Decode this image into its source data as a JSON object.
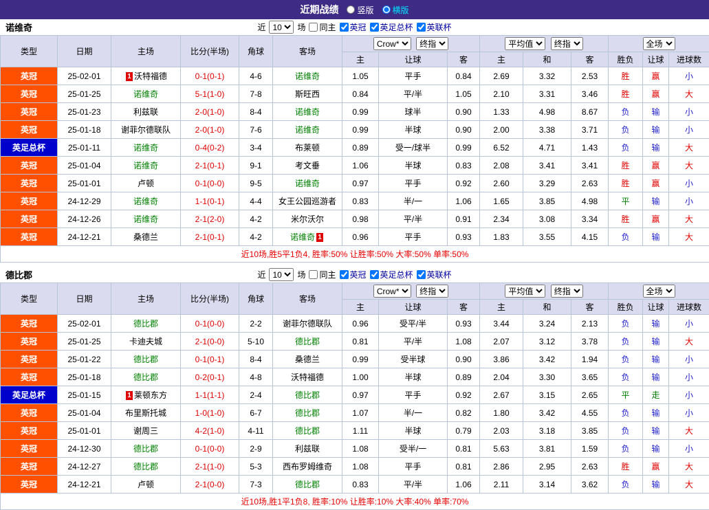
{
  "topbar": {
    "title": "近期战绩",
    "vertical_label": "竖版",
    "horizontal_label": "横版",
    "vertical_checked": false,
    "horizontal_checked": true
  },
  "controls": {
    "near_label": "近",
    "match_count": "10",
    "games_label": "场",
    "same_home_label": "同主",
    "same_home_checked": false,
    "league_filters": [
      {
        "label": "英冠",
        "checked": true
      },
      {
        "label": "英足总杯",
        "checked": true
      },
      {
        "label": "英联杯",
        "checked": true
      }
    ]
  },
  "columns": {
    "type": "类型",
    "date": "日期",
    "home": "主场",
    "score": "比分(半场)",
    "corner": "角球",
    "away": "客场",
    "asian_select": "Crow*",
    "asian_final_select": "终指",
    "asian_sub": [
      "主",
      "让球",
      "客"
    ],
    "euro_select": "平均值",
    "euro_final_select": "终指",
    "euro_sub": [
      "主",
      "和",
      "客"
    ],
    "full_select": "全场",
    "full_sub": [
      "胜负",
      "让球",
      "进球数"
    ]
  },
  "league_colors": {
    "英冠": "#ff5000",
    "英足总杯": "#0000cc"
  },
  "result_colors": {
    "胜": "#e00000",
    "负": "#2222cc",
    "平": "#008000",
    "赢": "#e00000",
    "输": "#2222cc",
    "走": "#008000",
    "大": "#e00000",
    "小": "#2222cc"
  },
  "sections": [
    {
      "team": "诺维奇",
      "summary": "近10场,胜5平1负4, 胜率:50% 让胜率:50% 大率:50% 单率:50%",
      "rows": [
        {
          "league": "英冠",
          "date": "25-02-01",
          "home": {
            "name": "沃特福德",
            "focus": false,
            "badge": "1",
            "badge_pos": "left"
          },
          "score": "0-1(0-1)",
          "corner": "4-6",
          "away": {
            "name": "诺维奇",
            "focus": true
          },
          "asian": [
            "1.05",
            "平手",
            "0.84"
          ],
          "euro": [
            "2.69",
            "3.32",
            "2.53"
          ],
          "result": [
            "胜",
            "赢",
            "小"
          ]
        },
        {
          "league": "英冠",
          "date": "25-01-25",
          "home": {
            "name": "诺维奇",
            "focus": true
          },
          "score": "5-1(1-0)",
          "corner": "7-8",
          "away": {
            "name": "斯旺西",
            "focus": false
          },
          "asian": [
            "0.84",
            "平/半",
            "1.05"
          ],
          "euro": [
            "2.10",
            "3.31",
            "3.46"
          ],
          "result": [
            "胜",
            "赢",
            "大"
          ]
        },
        {
          "league": "英冠",
          "date": "25-01-23",
          "home": {
            "name": "利兹联",
            "focus": false
          },
          "score": "2-0(1-0)",
          "corner": "8-4",
          "away": {
            "name": "诺维奇",
            "focus": true
          },
          "asian": [
            "0.99",
            "球半",
            "0.90"
          ],
          "euro": [
            "1.33",
            "4.98",
            "8.67"
          ],
          "result": [
            "负",
            "输",
            "小"
          ]
        },
        {
          "league": "英冠",
          "date": "25-01-18",
          "home": {
            "name": "谢菲尔德联队",
            "focus": false
          },
          "score": "2-0(1-0)",
          "corner": "7-6",
          "away": {
            "name": "诺维奇",
            "focus": true
          },
          "asian": [
            "0.99",
            "半球",
            "0.90"
          ],
          "euro": [
            "2.00",
            "3.38",
            "3.71"
          ],
          "result": [
            "负",
            "输",
            "小"
          ]
        },
        {
          "league": "英足总杯",
          "date": "25-01-11",
          "home": {
            "name": "诺维奇",
            "focus": true
          },
          "score": "0-4(0-2)",
          "corner": "3-4",
          "away": {
            "name": "布莱顿",
            "focus": false
          },
          "asian": [
            "0.89",
            "受一/球半",
            "0.99"
          ],
          "euro": [
            "6.52",
            "4.71",
            "1.43"
          ],
          "result": [
            "负",
            "输",
            "大"
          ]
        },
        {
          "league": "英冠",
          "date": "25-01-04",
          "home": {
            "name": "诺维奇",
            "focus": true
          },
          "score": "2-1(0-1)",
          "corner": "9-1",
          "away": {
            "name": "考文垂",
            "focus": false
          },
          "asian": [
            "1.06",
            "半球",
            "0.83"
          ],
          "euro": [
            "2.08",
            "3.41",
            "3.41"
          ],
          "result": [
            "胜",
            "赢",
            "大"
          ]
        },
        {
          "league": "英冠",
          "date": "25-01-01",
          "home": {
            "name": "卢顿",
            "focus": false
          },
          "score": "0-1(0-0)",
          "corner": "9-5",
          "away": {
            "name": "诺维奇",
            "focus": true
          },
          "asian": [
            "0.97",
            "平手",
            "0.92"
          ],
          "euro": [
            "2.60",
            "3.29",
            "2.63"
          ],
          "result": [
            "胜",
            "赢",
            "小"
          ]
        },
        {
          "league": "英冠",
          "date": "24-12-29",
          "home": {
            "name": "诺维奇",
            "focus": true
          },
          "score": "1-1(0-1)",
          "corner": "4-4",
          "away": {
            "name": "女王公园巡游者",
            "focus": false
          },
          "asian": [
            "0.83",
            "半/一",
            "1.06"
          ],
          "euro": [
            "1.65",
            "3.85",
            "4.98"
          ],
          "result": [
            "平",
            "输",
            "小"
          ]
        },
        {
          "league": "英冠",
          "date": "24-12-26",
          "home": {
            "name": "诺维奇",
            "focus": true
          },
          "score": "2-1(2-0)",
          "corner": "4-2",
          "away": {
            "name": "米尔沃尔",
            "focus": false
          },
          "asian": [
            "0.98",
            "平/半",
            "0.91"
          ],
          "euro": [
            "2.34",
            "3.08",
            "3.34"
          ],
          "result": [
            "胜",
            "赢",
            "大"
          ]
        },
        {
          "league": "英冠",
          "date": "24-12-21",
          "home": {
            "name": "桑德兰",
            "focus": false
          },
          "score": "2-1(0-1)",
          "corner": "4-2",
          "away": {
            "name": "诺维奇",
            "focus": true,
            "badge": "1",
            "badge_pos": "right"
          },
          "asian": [
            "0.96",
            "平手",
            "0.93"
          ],
          "euro": [
            "1.83",
            "3.55",
            "4.15"
          ],
          "result": [
            "负",
            "输",
            "大"
          ]
        }
      ]
    },
    {
      "team": "德比郡",
      "summary": "近10场,胜1平1负8, 胜率:10% 让胜率:10% 大率:40% 单率:70%",
      "rows": [
        {
          "league": "英冠",
          "date": "25-02-01",
          "home": {
            "name": "德比郡",
            "focus": true
          },
          "score": "0-1(0-0)",
          "corner": "2-2",
          "away": {
            "name": "谢菲尔德联队",
            "focus": false
          },
          "asian": [
            "0.96",
            "受平/半",
            "0.93"
          ],
          "euro": [
            "3.44",
            "3.24",
            "2.13"
          ],
          "result": [
            "负",
            "输",
            "小"
          ]
        },
        {
          "league": "英冠",
          "date": "25-01-25",
          "home": {
            "name": "卡迪夫城",
            "focus": false
          },
          "score": "2-1(0-0)",
          "corner": "5-10",
          "away": {
            "name": "德比郡",
            "focus": true
          },
          "asian": [
            "0.81",
            "平/半",
            "1.08"
          ],
          "euro": [
            "2.07",
            "3.12",
            "3.78"
          ],
          "result": [
            "负",
            "输",
            "大"
          ]
        },
        {
          "league": "英冠",
          "date": "25-01-22",
          "home": {
            "name": "德比郡",
            "focus": true
          },
          "score": "0-1(0-1)",
          "corner": "8-4",
          "away": {
            "name": "桑德兰",
            "focus": false
          },
          "asian": [
            "0.99",
            "受半球",
            "0.90"
          ],
          "euro": [
            "3.86",
            "3.42",
            "1.94"
          ],
          "result": [
            "负",
            "输",
            "小"
          ]
        },
        {
          "league": "英冠",
          "date": "25-01-18",
          "home": {
            "name": "德比郡",
            "focus": true
          },
          "score": "0-2(0-1)",
          "corner": "4-8",
          "away": {
            "name": "沃特福德",
            "focus": false
          },
          "asian": [
            "1.00",
            "半球",
            "0.89"
          ],
          "euro": [
            "2.04",
            "3.30",
            "3.65"
          ],
          "result": [
            "负",
            "输",
            "小"
          ]
        },
        {
          "league": "英足总杯",
          "date": "25-01-15",
          "home": {
            "name": "莱顿东方",
            "focus": false,
            "badge": "1",
            "badge_pos": "left"
          },
          "score": "1-1(1-1)",
          "corner": "2-4",
          "away": {
            "name": "德比郡",
            "focus": true
          },
          "asian": [
            "0.97",
            "平手",
            "0.92"
          ],
          "euro": [
            "2.67",
            "3.15",
            "2.65"
          ],
          "result": [
            "平",
            "走",
            "小"
          ]
        },
        {
          "league": "英冠",
          "date": "25-01-04",
          "home": {
            "name": "布里斯托城",
            "focus": false
          },
          "score": "1-0(1-0)",
          "corner": "6-7",
          "away": {
            "name": "德比郡",
            "focus": true
          },
          "asian": [
            "1.07",
            "半/一",
            "0.82"
          ],
          "euro": [
            "1.80",
            "3.42",
            "4.55"
          ],
          "result": [
            "负",
            "输",
            "小"
          ]
        },
        {
          "league": "英冠",
          "date": "25-01-01",
          "home": {
            "name": "谢周三",
            "focus": false
          },
          "score": "4-2(1-0)",
          "corner": "4-11",
          "away": {
            "name": "德比郡",
            "focus": true
          },
          "asian": [
            "1.11",
            "半球",
            "0.79"
          ],
          "euro": [
            "2.03",
            "3.18",
            "3.85"
          ],
          "result": [
            "负",
            "输",
            "大"
          ]
        },
        {
          "league": "英冠",
          "date": "24-12-30",
          "home": {
            "name": "德比郡",
            "focus": true
          },
          "score": "0-1(0-0)",
          "corner": "2-9",
          "away": {
            "name": "利兹联",
            "focus": false
          },
          "asian": [
            "1.08",
            "受半/一",
            "0.81"
          ],
          "euro": [
            "5.63",
            "3.81",
            "1.59"
          ],
          "result": [
            "负",
            "输",
            "小"
          ]
        },
        {
          "league": "英冠",
          "date": "24-12-27",
          "home": {
            "name": "德比郡",
            "focus": true
          },
          "score": "2-1(1-0)",
          "corner": "5-3",
          "away": {
            "name": "西布罗姆维奇",
            "focus": false
          },
          "asian": [
            "1.08",
            "平手",
            "0.81"
          ],
          "euro": [
            "2.86",
            "2.95",
            "2.63"
          ],
          "result": [
            "胜",
            "赢",
            "大"
          ]
        },
        {
          "league": "英冠",
          "date": "24-12-21",
          "home": {
            "name": "卢顿",
            "focus": false
          },
          "score": "2-1(0-0)",
          "corner": "7-3",
          "away": {
            "name": "德比郡",
            "focus": true
          },
          "asian": [
            "0.83",
            "平/半",
            "1.06"
          ],
          "euro": [
            "2.11",
            "3.14",
            "3.62"
          ],
          "result": [
            "负",
            "输",
            "大"
          ]
        }
      ]
    }
  ]
}
